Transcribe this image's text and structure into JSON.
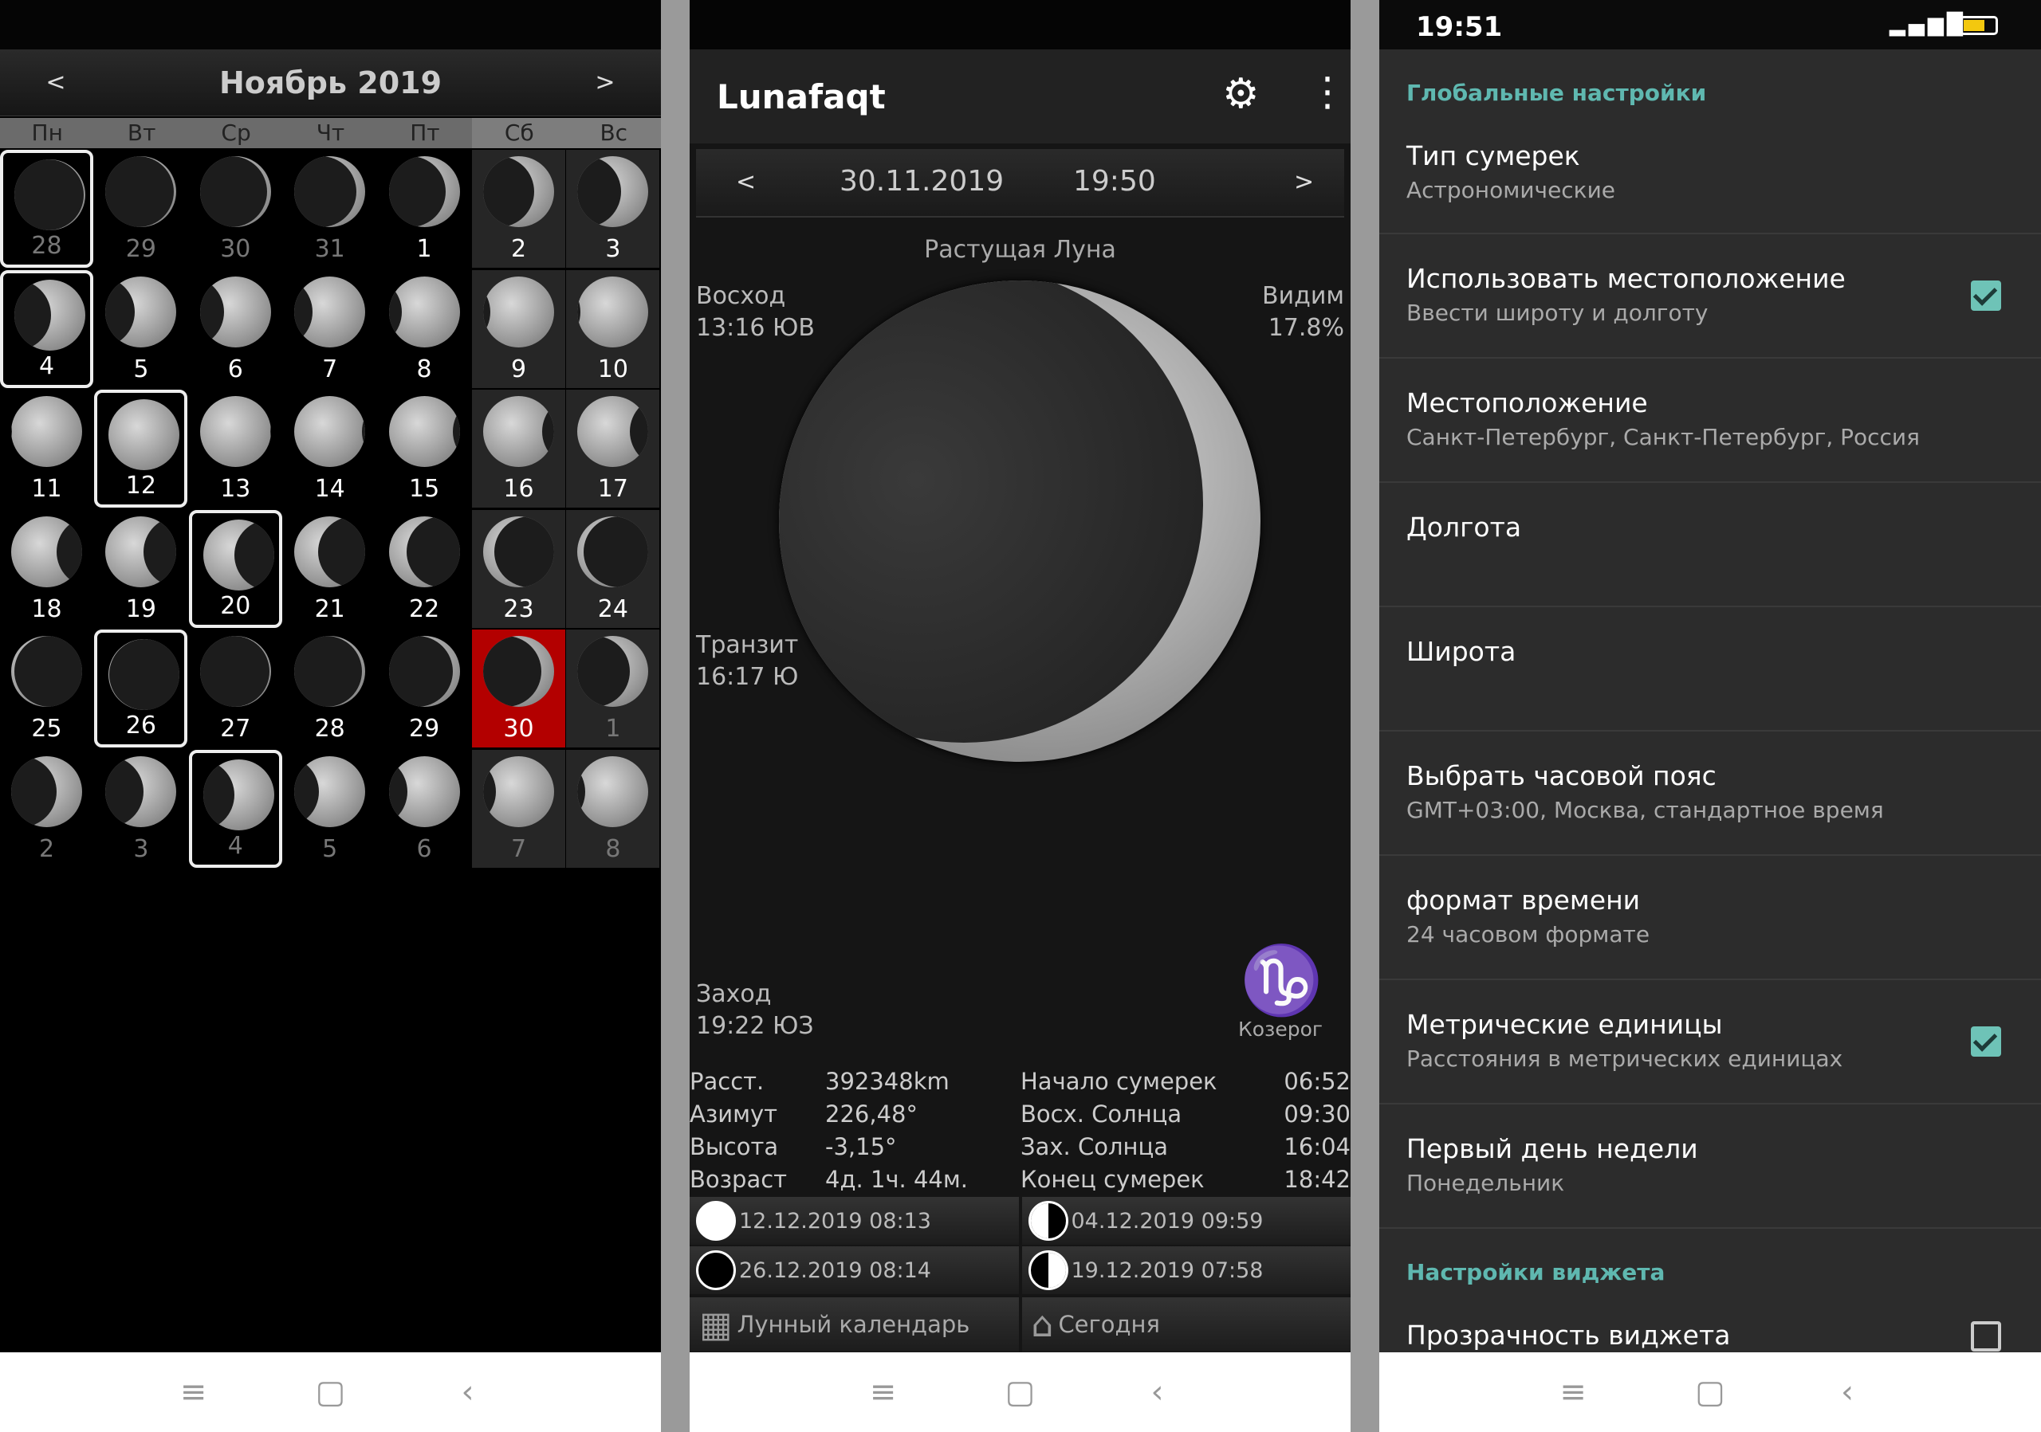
{
  "calendar": {
    "month_title": "Ноябрь 2019",
    "prev": "<",
    "next": ">",
    "weekdays": [
      "Пн",
      "Вт",
      "Ср",
      "Чт",
      "Пт",
      "Сб",
      "Вс"
    ],
    "days": [
      {
        "n": "28",
        "other": true,
        "sel": true,
        "phase": 0.02,
        "wax": true
      },
      {
        "n": "29",
        "other": true,
        "phase": 0.03,
        "wax": true
      },
      {
        "n": "30",
        "other": true,
        "phase": 0.06,
        "wax": true
      },
      {
        "n": "31",
        "other": true,
        "phase": 0.12,
        "wax": true
      },
      {
        "n": "1",
        "phase": 0.2,
        "wax": true
      },
      {
        "n": "2",
        "phase": 0.28,
        "wax": true
      },
      {
        "n": "3",
        "phase": 0.38,
        "wax": true
      },
      {
        "n": "4",
        "sel": true,
        "phase": 0.48,
        "wax": true
      },
      {
        "n": "5",
        "phase": 0.58,
        "wax": true
      },
      {
        "n": "6",
        "phase": 0.66,
        "wax": true
      },
      {
        "n": "7",
        "phase": 0.74,
        "wax": true
      },
      {
        "n": "8",
        "phase": 0.82,
        "wax": true
      },
      {
        "n": "9",
        "phase": 0.9,
        "wax": true
      },
      {
        "n": "10",
        "phase": 0.95,
        "wax": true
      },
      {
        "n": "11",
        "phase": 0.99,
        "wax": true
      },
      {
        "n": "12",
        "sel": true,
        "phase": 1.0,
        "wax": true
      },
      {
        "n": "13",
        "phase": 0.99,
        "wax": false
      },
      {
        "n": "14",
        "phase": 0.96,
        "wax": false
      },
      {
        "n": "15",
        "phase": 0.9,
        "wax": false
      },
      {
        "n": "16",
        "phase": 0.83,
        "wax": false
      },
      {
        "n": "17",
        "phase": 0.74,
        "wax": false
      },
      {
        "n": "18",
        "phase": 0.64,
        "wax": false
      },
      {
        "n": "19",
        "phase": 0.54,
        "wax": false
      },
      {
        "n": "20",
        "sel": true,
        "phase": 0.44,
        "wax": false
      },
      {
        "n": "21",
        "phase": 0.34,
        "wax": false
      },
      {
        "n": "22",
        "phase": 0.25,
        "wax": false
      },
      {
        "n": "23",
        "phase": 0.16,
        "wax": false
      },
      {
        "n": "24",
        "phase": 0.09,
        "wax": false
      },
      {
        "n": "25",
        "phase": 0.04,
        "wax": false
      },
      {
        "n": "26",
        "sel": true,
        "phase": 0.01,
        "wax": false
      },
      {
        "n": "27",
        "phase": 0.02,
        "wax": true
      },
      {
        "n": "28",
        "phase": 0.05,
        "wax": true
      },
      {
        "n": "29",
        "phase": 0.1,
        "wax": true
      },
      {
        "n": "30",
        "today": true,
        "phase": 0.18,
        "wax": true
      },
      {
        "n": "1",
        "other": true,
        "phase": 0.26,
        "wax": true
      },
      {
        "n": "2",
        "other": true,
        "phase": 0.36,
        "wax": true
      },
      {
        "n": "3",
        "other": true,
        "phase": 0.46,
        "wax": true
      },
      {
        "n": "4",
        "other": true,
        "sel": true,
        "phase": 0.56,
        "wax": true
      },
      {
        "n": "5",
        "other": true,
        "phase": 0.65,
        "wax": true
      },
      {
        "n": "6",
        "other": true,
        "phase": 0.74,
        "wax": true
      },
      {
        "n": "7",
        "other": true,
        "phase": 0.82,
        "wax": true
      },
      {
        "n": "8",
        "other": true,
        "phase": 0.89,
        "wax": true
      }
    ]
  },
  "luna": {
    "app_title": "Lunafaqt",
    "prev": "<",
    "next": ">",
    "date": "30.11.2019",
    "time": "19:50",
    "phase_name": "Растущая Луна",
    "illumination": 0.178,
    "rise_label": "Восход",
    "rise_value": "13:16 ЮВ",
    "visible_label": "Видим",
    "visible_value": "17.8%",
    "transit_label": "Транзит",
    "transit_value": "16:17 Ю",
    "set_label": "Заход",
    "set_value": "19:22 ЮЗ",
    "zodiac_symbol": "♑",
    "zodiac_name": "Козерог",
    "stats": [
      {
        "l1": "Расст.",
        "v1": "392348km",
        "l2": "Начало сумерек",
        "v2": "06:52"
      },
      {
        "l1": "Азимут",
        "v1": "226,48°",
        "l2": "Восх. Солнца",
        "v2": "09:30"
      },
      {
        "l1": "Высота",
        "v1": "-3,15°",
        "l2": "Зах. Солнца",
        "v2": "16:04"
      },
      {
        "l1": "Возраст",
        "v1": "4д. 1ч. 44м.",
        "l2": "Конец сумерек",
        "v2": "18:42"
      }
    ],
    "phases": {
      "full": "12.12.2019 08:13",
      "last_quarter": "04.12.2019 09:59",
      "new": "26.12.2019 08:14",
      "first_quarter": "19.12.2019 07:58"
    },
    "lunar_calendar_btn": "Лунный календарь",
    "today_btn": "Сегодня"
  },
  "settings": {
    "clock": "19:51",
    "battery": 0.64,
    "global_section": "Глобальные настройки",
    "twilight_title": "Тип сумерек",
    "twilight_value": "Астрономические",
    "use_location_title": "Использовать местоположение",
    "use_location_sub": "Ввести широту и долготу",
    "use_location_checked": true,
    "location_title": "Местоположение",
    "location_value": "Санкт-Петербург, Санкт-Петербург, Россия",
    "longitude_title": "Долгота",
    "latitude_title": "Широта",
    "timezone_title": "Выбрать часовой пояс",
    "timezone_value": "GMT+03:00, Москва, стандартное время",
    "timeformat_title": "формат времени",
    "timeformat_value": "24 часовом формате",
    "metric_title": "Метрические единицы",
    "metric_sub": "Расстояния в метрических единицах",
    "metric_checked": true,
    "firstday_title": "Первый день недели",
    "firstday_value": "Понедельник",
    "widget_section": "Настройки виджета",
    "transparency_title": "Прозрачность виджета",
    "transparency_checked": false
  },
  "icons": {
    "menu": "≡",
    "home": "▢",
    "back": "‹",
    "gear": "⚙",
    "more": "⋮",
    "calendar": "▦",
    "house": "⌂",
    "signal": "▂▄▆█"
  }
}
